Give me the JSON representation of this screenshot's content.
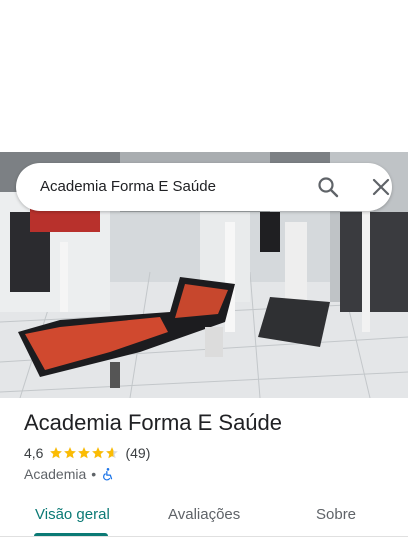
{
  "search": {
    "query": "Academia Forma E Saúde"
  },
  "place": {
    "name": "Academia Forma E Saúde",
    "rating": "4,6",
    "rating_fraction": 0.92,
    "review_count": "(49)",
    "category": "Academia",
    "separator": "•"
  },
  "tabs": [
    {
      "label": "Visão geral",
      "active": true
    },
    {
      "label": "Avaliações",
      "active": false
    },
    {
      "label": "Sobre",
      "active": false
    }
  ],
  "icons": {
    "search": "search-icon",
    "close": "close-icon",
    "star": "star-icon",
    "accessibility": "wheelchair-icon"
  },
  "colors": {
    "accent": "#0b7a75",
    "star": "#fbbc04",
    "accessibility": "#1a73e8"
  }
}
